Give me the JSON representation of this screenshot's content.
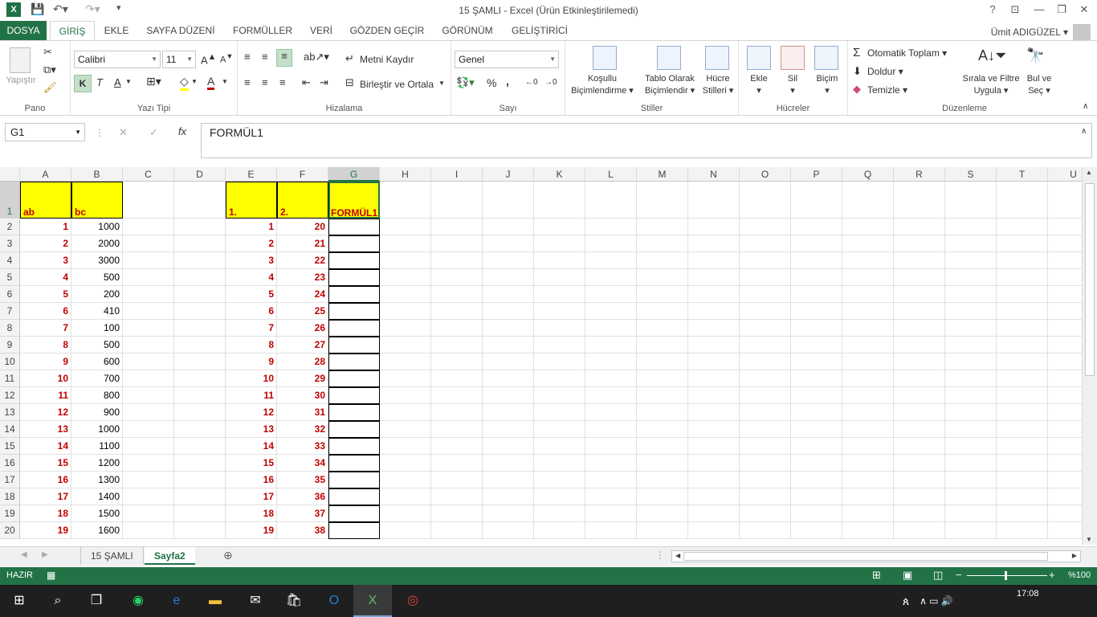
{
  "window": {
    "title": "15 ŞAMLI - Excel (Ürün Etkinleştirilemedi)",
    "help": "?",
    "minimize": "—",
    "restore": "❐",
    "close": "✕"
  },
  "ribbon_tabs": [
    "DOSYA",
    "GİRİŞ",
    "EKLE",
    "SAYFA DÜZENİ",
    "FORMÜLLER",
    "VERİ",
    "GÖZDEN GEÇİR",
    "GÖRÜNÜM",
    "GELİŞTİRİCİ"
  ],
  "user_name": "Ümit ADIGÜZEL",
  "ribbon": {
    "clipboard": {
      "paste": "Yapıştır",
      "label": "Pano"
    },
    "font": {
      "name": "Calibri",
      "size": "11",
      "bold": "K",
      "italic": "T",
      "underline": "A",
      "label": "Yazı Tipi"
    },
    "alignment": {
      "wrap": "Metni Kaydır",
      "merge": "Birleştir ve Ortala",
      "label": "Hizalama"
    },
    "number": {
      "format": "Genel",
      "percent": "%",
      "comma": ",",
      "label": "Sayı"
    },
    "styles": {
      "conditional": [
        "Koşullu",
        "Biçimlendirme"
      ],
      "table": [
        "Tablo Olarak",
        "Biçimlendir"
      ],
      "cell": [
        "Hücre",
        "Stilleri"
      ],
      "label": "Stiller"
    },
    "cells": {
      "insert": "Ekle",
      "delete": "Sil",
      "format": "Biçim",
      "label": "Hücreler"
    },
    "editing": {
      "autosum": "Otomatik Toplam",
      "fill": "Doldur",
      "clear": "Temizle",
      "sort": [
        "Sırala ve Filtre",
        "Uygula"
      ],
      "find": [
        "Bul ve",
        "Seç"
      ],
      "label": "Düzenleme"
    }
  },
  "formula_bar": {
    "name_box": "G1",
    "cancel": "✕",
    "enter": "✓",
    "fx": "fx",
    "content": "FORMÜL1"
  },
  "columns": [
    "A",
    "B",
    "C",
    "D",
    "E",
    "F",
    "G",
    "H",
    "I",
    "J",
    "K",
    "L",
    "M",
    "N",
    "O",
    "P",
    "Q",
    "R",
    "S",
    "T",
    "U"
  ],
  "selected_column": "G",
  "header_row": {
    "A": "ab",
    "B": "bc",
    "E": "1.",
    "F": "2.",
    "G": "FORMÜL1"
  },
  "rows": [
    {
      "n": "2",
      "A": "1",
      "B": "1000",
      "E": "1",
      "F": "20"
    },
    {
      "n": "3",
      "A": "2",
      "B": "2000",
      "E": "2",
      "F": "21"
    },
    {
      "n": "4",
      "A": "3",
      "B": "3000",
      "E": "3",
      "F": "22"
    },
    {
      "n": "5",
      "A": "4",
      "B": "500",
      "E": "4",
      "F": "23"
    },
    {
      "n": "6",
      "A": "5",
      "B": "200",
      "E": "5",
      "F": "24"
    },
    {
      "n": "7",
      "A": "6",
      "B": "410",
      "E": "6",
      "F": "25"
    },
    {
      "n": "8",
      "A": "7",
      "B": "100",
      "E": "7",
      "F": "26"
    },
    {
      "n": "9",
      "A": "8",
      "B": "500",
      "E": "8",
      "F": "27"
    },
    {
      "n": "10",
      "A": "9",
      "B": "600",
      "E": "9",
      "F": "28"
    },
    {
      "n": "11",
      "A": "10",
      "B": "700",
      "E": "10",
      "F": "29"
    },
    {
      "n": "12",
      "A": "11",
      "B": "800",
      "E": "11",
      "F": "30"
    },
    {
      "n": "13",
      "A": "12",
      "B": "900",
      "E": "12",
      "F": "31"
    },
    {
      "n": "14",
      "A": "13",
      "B": "1000",
      "E": "13",
      "F": "32"
    },
    {
      "n": "15",
      "A": "14",
      "B": "1100",
      "E": "14",
      "F": "33"
    },
    {
      "n": "16",
      "A": "15",
      "B": "1200",
      "E": "15",
      "F": "34"
    },
    {
      "n": "17",
      "A": "16",
      "B": "1300",
      "E": "16",
      "F": "35"
    },
    {
      "n": "18",
      "A": "17",
      "B": "1400",
      "E": "17",
      "F": "36"
    },
    {
      "n": "19",
      "A": "18",
      "B": "1500",
      "E": "18",
      "F": "37"
    },
    {
      "n": "20",
      "A": "19",
      "B": "1600",
      "E": "19",
      "F": "38"
    }
  ],
  "sheets": [
    {
      "name": "15 ŞAMLI",
      "active": false
    },
    {
      "name": "Sayfa2",
      "active": true
    }
  ],
  "status": {
    "ready": "HAZIR",
    "zoom": "%100"
  },
  "taskbar": {
    "time": "17:08"
  },
  "colors": {
    "excel_green": "#217346",
    "header_yellow": "#ffff00",
    "value_red": "#c00000"
  }
}
